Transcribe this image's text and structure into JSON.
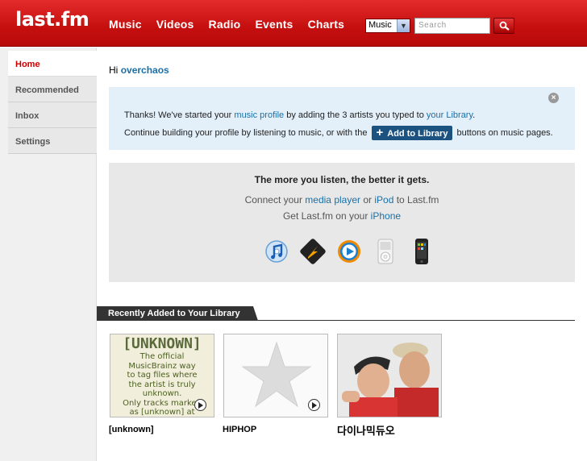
{
  "header": {
    "logo": "last.fm",
    "nav": [
      "Music",
      "Videos",
      "Radio",
      "Events",
      "Charts"
    ],
    "search_scope": "Music",
    "search_placeholder": "Search"
  },
  "sidebar": {
    "items": [
      {
        "label": "Home",
        "active": true
      },
      {
        "label": "Recommended",
        "active": false
      },
      {
        "label": "Inbox",
        "active": false
      },
      {
        "label": "Settings",
        "active": false
      }
    ]
  },
  "greeting": {
    "prefix": "Hi",
    "username": "overchaos"
  },
  "notice": {
    "line1_a": "Thanks! We've started your ",
    "line1_link1": "music profile",
    "line1_b": " by adding the 3 artists you typed to ",
    "line1_link2": "your Library",
    "line1_c": ".",
    "line2_a": "Continue building your profile by listening to music, or with the",
    "add_button": "Add to Library",
    "line2_b": "buttons on music pages."
  },
  "listen": {
    "title": "The more you listen, the better it gets.",
    "line1_a": "Connect your ",
    "line1_link1": "media player",
    "line1_b": " or ",
    "line1_link2": "iPod",
    "line1_c": " to Last.fm",
    "line2_a": "Get Last.fm on your ",
    "line2_link": "iPhone",
    "devices": [
      "itunes-icon",
      "winamp-icon",
      "windows-media-player-icon",
      "ipod-icon",
      "iphone-icon"
    ]
  },
  "recent": {
    "heading": "Recently Added to Your Library",
    "artists": [
      {
        "name": "[unknown]",
        "art_title": "[UNKNOWN]",
        "art_text": [
          "The official",
          "MusicBrainz way",
          "to tag files where",
          "the artist is truly",
          "unknown.",
          "Only tracks marked",
          "as [unknown] at"
        ]
      },
      {
        "name": "HIPHOP"
      },
      {
        "name": "다이나믹듀오"
      }
    ]
  },
  "colors": {
    "brand_red": "#d51007",
    "link_blue": "#1a6fa8",
    "button_blue": "#1c5280"
  }
}
